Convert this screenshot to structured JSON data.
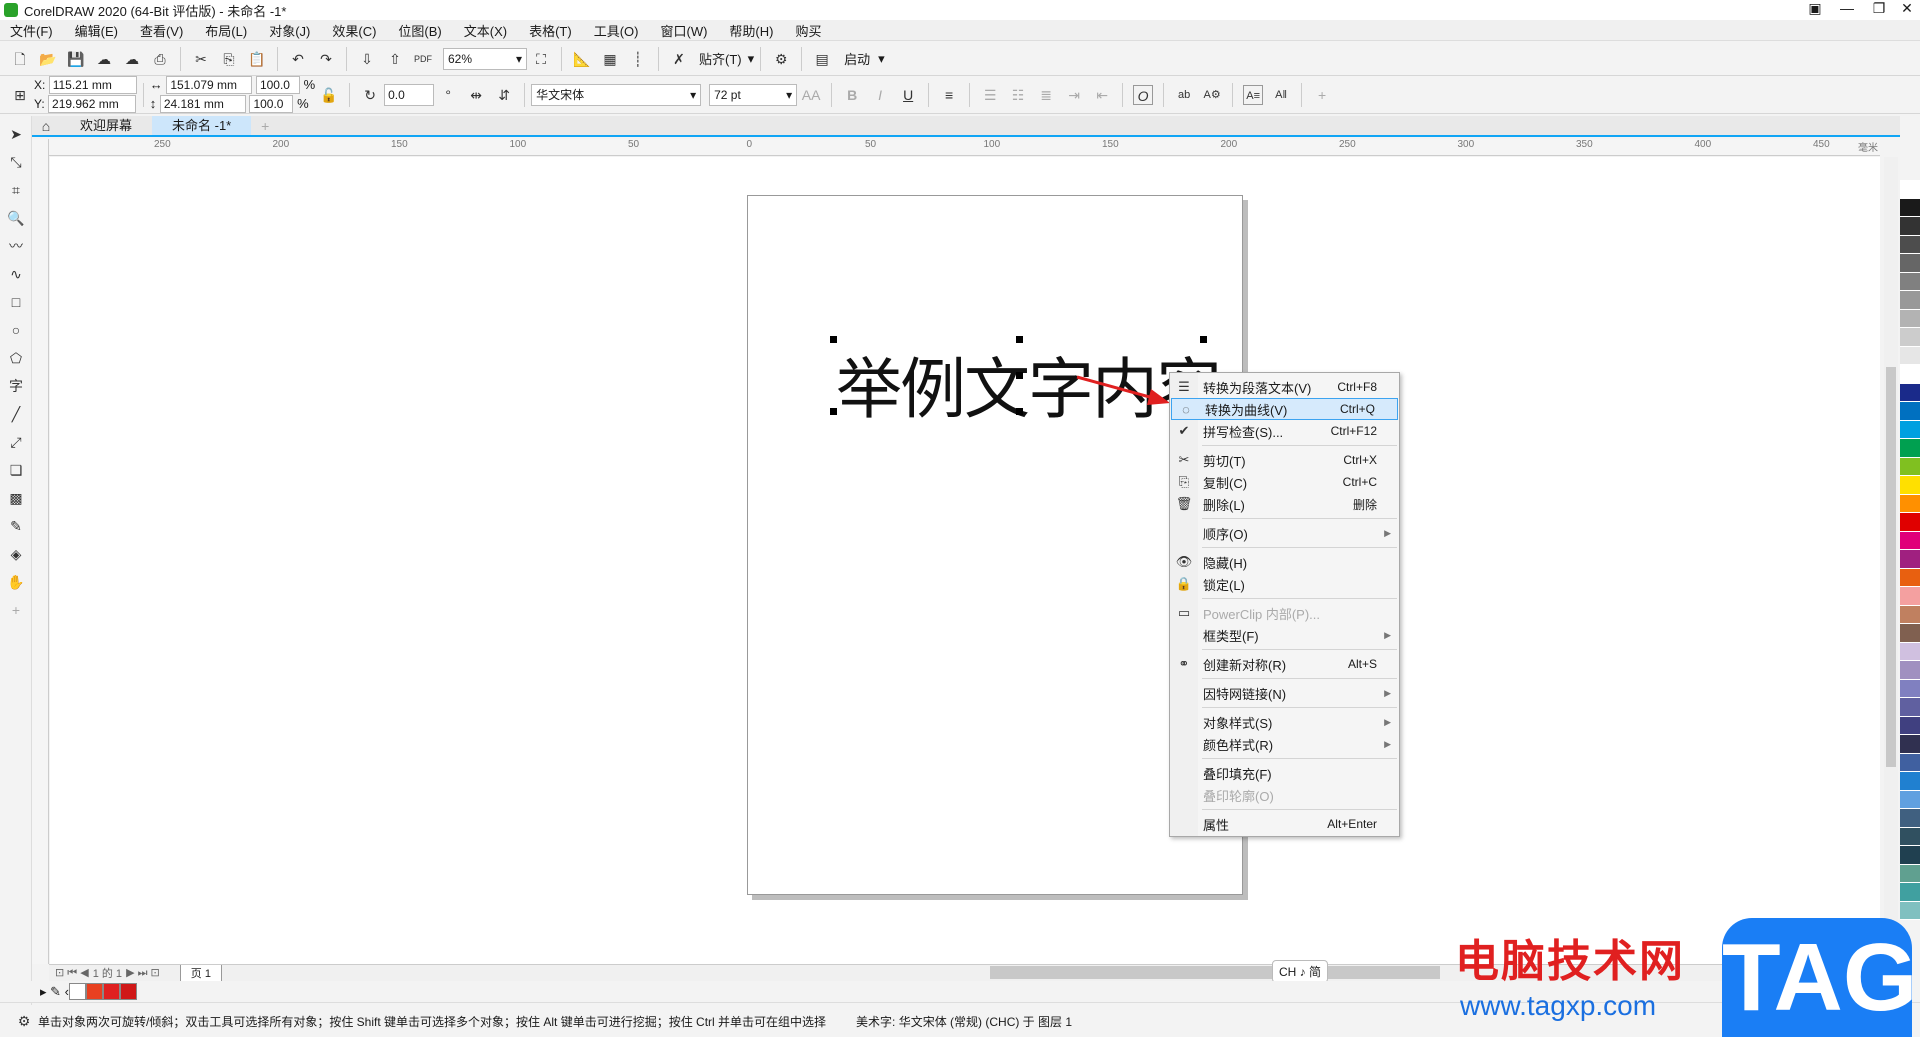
{
  "window": {
    "title": "CorelDRAW 2020 (64-Bit 评估版) - 未命名 -1*",
    "controls": [
      "minimize",
      "restore",
      "close"
    ]
  },
  "menu": [
    "文件(F)",
    "编辑(E)",
    "查看(V)",
    "布局(L)",
    "对象(J)",
    "效果(C)",
    "位图(B)",
    "文本(X)",
    "表格(T)",
    "工具(O)",
    "窗口(W)",
    "帮助(H)",
    "购买"
  ],
  "toolbar1": {
    "zoom": "62%",
    "snap": "贴齐(T)",
    "launch": "启动"
  },
  "toolbar2": {
    "x": "115.21 mm",
    "y": "219.962 mm",
    "x_label": "X:",
    "y_label": "Y:",
    "width": "151.079 mm",
    "height": "24.181 mm",
    "scale_w": "100.0",
    "scale_h": "100.0",
    "pct": "%",
    "rotation": "0.0",
    "font": "华文宋体",
    "size": "72 pt"
  },
  "tabs": [
    {
      "label": "欢迎屏幕"
    },
    {
      "label": "未命名 -1*",
      "active": true
    }
  ],
  "ruler": {
    "unit": "毫米",
    "ticks": [
      "250",
      "200",
      "150",
      "100",
      "50",
      "0",
      "50",
      "100",
      "150",
      "200",
      "250",
      "300",
      "350",
      "400",
      "450"
    ]
  },
  "canvas": {
    "text": "举例文字内容"
  },
  "context_menu": [
    {
      "label": "转换为段落文本(V)",
      "shortcut": "Ctrl+F8",
      "icon": "paragraph-text-icon"
    },
    {
      "label": "转换为曲线(V)",
      "shortcut": "Ctrl+Q",
      "icon": "curve-icon",
      "highlight": true
    },
    {
      "label": "拼写检查(S)...",
      "shortcut": "Ctrl+F12",
      "icon": "spell-check-icon"
    },
    {
      "sep": true
    },
    {
      "label": "剪切(T)",
      "shortcut": "Ctrl+X",
      "icon": "cut-icon"
    },
    {
      "label": "复制(C)",
      "shortcut": "Ctrl+C",
      "icon": "copy-icon"
    },
    {
      "label": "删除(L)",
      "shortcut": "删除",
      "icon": "trash-icon"
    },
    {
      "sep": true
    },
    {
      "label": "顺序(O)",
      "submenu": true
    },
    {
      "sep": true
    },
    {
      "label": "隐藏(H)",
      "icon": "hide-icon"
    },
    {
      "label": "锁定(L)",
      "icon": "lock-icon"
    },
    {
      "sep": true
    },
    {
      "label": "PowerClip 内部(P)...",
      "icon": "powerclip-icon",
      "disabled": true
    },
    {
      "label": "框类型(F)",
      "submenu": true
    },
    {
      "sep": true
    },
    {
      "label": "创建新对称(R)",
      "shortcut": "Alt+S",
      "icon": "symmetry-icon"
    },
    {
      "sep": true
    },
    {
      "label": "因特网链接(N)",
      "submenu": true
    },
    {
      "sep": true
    },
    {
      "label": "对象样式(S)",
      "submenu": true
    },
    {
      "label": "颜色样式(R)",
      "submenu": true
    },
    {
      "sep": true
    },
    {
      "label": "叠印填充(F)"
    },
    {
      "label": "叠印轮廓(O)",
      "disabled": true
    },
    {
      "sep": true
    },
    {
      "label": "属性",
      "shortcut": "Alt+Enter"
    }
  ],
  "pagenav": {
    "counter": "1 的 1",
    "page_tab": "页 1"
  },
  "ime": "CH ♪ 简",
  "status": {
    "hint": "单击对象两次可旋转/倾斜；双击工具可选择所有对象；按住 Shift 键单击可选择多个对象；按住 Alt 键单击可进行挖掘；按住 Ctrl 并单击可在组中选择",
    "object": "美术字: 华文宋体 (常规) (CHC) 于 图层 1"
  },
  "watermark": {
    "cn": "电脑技术网",
    "url": "www.tagxp.com",
    "logo": "TAG"
  },
  "palette": [
    "#ffffff",
    "#1a1a1a",
    "#333333",
    "#4d4d4d",
    "#666666",
    "#808080",
    "#999999",
    "#b3b3b3",
    "#cccccc",
    "#e6e6e6",
    "#ffffff",
    "#1a2a8a",
    "#0070c0",
    "#00a0e0",
    "#00a050",
    "#80c020",
    "#ffe000",
    "#ff9000",
    "#e00000",
    "#e0007a",
    "#a02080",
    "#e86010",
    "#f4a0a0",
    "#c08060",
    "#806050",
    "#d0c0e0",
    "#a090c0",
    "#8080c0",
    "#6060a0",
    "#404080",
    "#303050",
    "#4060a0",
    "#2080d0",
    "#60a0e0",
    "#406080",
    "#305060",
    "#204050",
    "#60a090",
    "#40a0a0",
    "#80c0c0"
  ],
  "colors": {
    "accent": "#10a5f5",
    "highlight": "#d6eafc",
    "fill_red": "#e02020"
  }
}
